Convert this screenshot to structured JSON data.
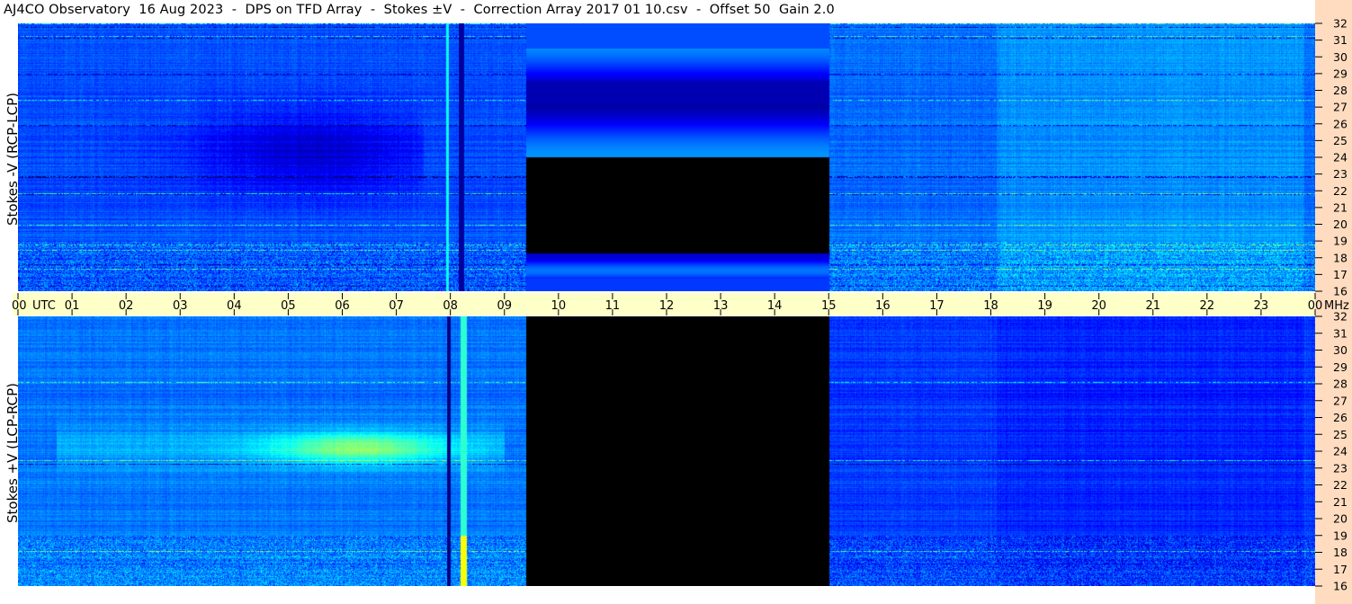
{
  "header": {
    "title": "AJ4CO Observatory  16 Aug 2023  -  DPS on TFD Array  -  Stokes ±V  -  Correction Array 2017 01 10.csv  -  Offset 50  Gain 2.0"
  },
  "chart_data": [
    {
      "type": "heatmap",
      "panel": "top",
      "ylabel": "Stokes -V (RCP-LCP)",
      "xlim_utc_hours": [
        0,
        24
      ],
      "ylim_mhz": [
        16,
        32
      ],
      "data_gap_utc_hours": [
        9.4,
        15.0
      ],
      "gap_pattern": "blue bands above ~24 MHz, black below ~24 MHz, blue band at ~17.5 MHz"
    },
    {
      "type": "heatmap",
      "panel": "bottom",
      "ylabel": "Stokes +V (LCP-RCP)",
      "xlim_utc_hours": [
        0,
        24
      ],
      "ylim_mhz": [
        16,
        32
      ],
      "data_gap_utc_hours": [
        9.4,
        15.0
      ],
      "gap_pattern": "black"
    }
  ],
  "time_axis": {
    "ticks": [
      "00",
      "01",
      "02",
      "03",
      "04",
      "05",
      "06",
      "07",
      "08",
      "09",
      "10",
      "11",
      "12",
      "13",
      "14",
      "15",
      "16",
      "17",
      "18",
      "19",
      "20",
      "21",
      "22",
      "23",
      "00"
    ],
    "start_unit": "UTC",
    "end_unit": "MHz"
  },
  "freq_axis": {
    "ticks": [
      "32",
      "31",
      "30",
      "29",
      "28",
      "27",
      "26",
      "25",
      "24",
      "23",
      "22",
      "21",
      "20",
      "19",
      "18",
      "17",
      "16"
    ]
  },
  "colors": {
    "band_background": "#ffffc8",
    "right_panel": "#ffdcc0",
    "gap_black": "#000000"
  }
}
